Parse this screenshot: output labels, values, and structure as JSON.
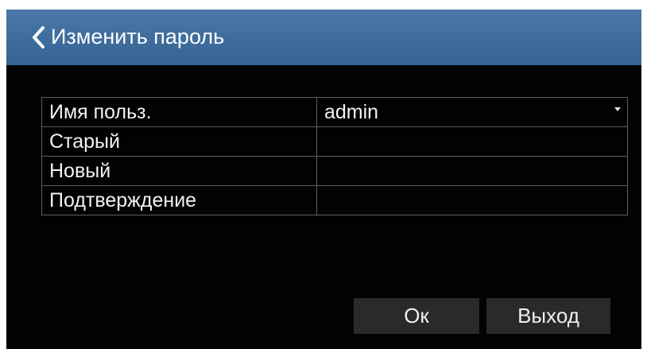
{
  "dialog": {
    "title": "Изменить пароль",
    "back_icon": "chevron-left-icon",
    "title_bar_color": "#3e6c9c",
    "background_color": "#020202"
  },
  "form": {
    "rows": [
      {
        "label": "Имя польз.",
        "value": "admin",
        "type": "select"
      },
      {
        "label": "Старый",
        "value": "",
        "type": "password"
      },
      {
        "label": "Новый",
        "value": "",
        "type": "password"
      },
      {
        "label": "Подтверждение",
        "value": "",
        "type": "password"
      }
    ],
    "dropdown_icon": "caret-down-icon"
  },
  "buttons": {
    "ok_label": "Ок",
    "exit_label": "Выход"
  }
}
